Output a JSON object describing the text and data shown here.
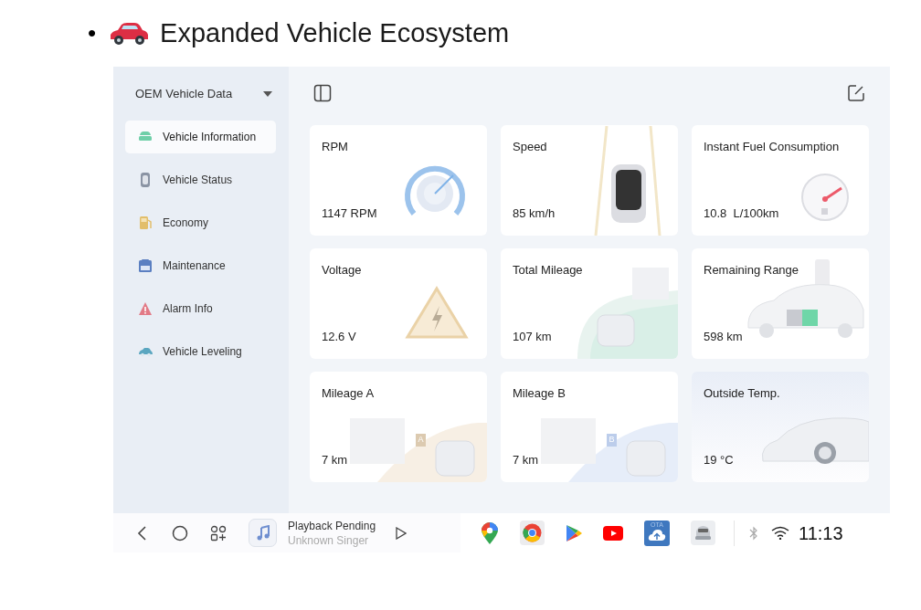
{
  "heading": {
    "bullet": "•",
    "title": "Expanded Vehicle Ecosystem"
  },
  "sidebar": {
    "title": "OEM Vehicle Data",
    "items": [
      {
        "label": "Vehicle Information",
        "kind": "info",
        "selected": true
      },
      {
        "label": "Vehicle Status",
        "kind": "status",
        "selected": false
      },
      {
        "label": "Economy",
        "kind": "economy",
        "selected": false
      },
      {
        "label": "Maintenance",
        "kind": "maintenance",
        "selected": false
      },
      {
        "label": "Alarm Info",
        "kind": "alarm",
        "selected": false
      },
      {
        "label": "Vehicle Leveling",
        "kind": "leveling",
        "selected": false
      }
    ]
  },
  "cards": [
    {
      "title": "RPM",
      "value": "1147 RPM",
      "kind": "rpm"
    },
    {
      "title": "Speed",
      "value": "85 km/h",
      "kind": "speed"
    },
    {
      "title": "Instant Fuel Consumption",
      "value": "10.8  L/100km",
      "kind": "fuel"
    },
    {
      "title": "Voltage",
      "value": "12.6 V",
      "kind": "voltage"
    },
    {
      "title": "Total Mileage",
      "value": "107 km",
      "kind": "mileage"
    },
    {
      "title": "Remaining Range",
      "value": "598 km",
      "kind": "range"
    },
    {
      "title": "Mileage A",
      "value": "7 km",
      "kind": "trip",
      "sign": "A"
    },
    {
      "title": "Mileage B",
      "value": "7 km",
      "kind": "trip",
      "sign": "B"
    },
    {
      "title": "Outside Temp.",
      "value": "19 °C",
      "kind": "temp"
    }
  ],
  "dock": {
    "nav": [
      {
        "kind": "back"
      },
      {
        "kind": "home"
      },
      {
        "kind": "apps"
      }
    ],
    "media": {
      "title": "Playback Pending",
      "artist": "Unknown Singer"
    },
    "apps": [
      {
        "kind": "maps"
      },
      {
        "kind": "browser"
      },
      {
        "kind": "store"
      },
      {
        "kind": "video"
      },
      {
        "kind": "ota",
        "label": "OTA"
      },
      {
        "kind": "car"
      }
    ],
    "status": [
      {
        "kind": "bluetooth"
      },
      {
        "kind": "wifi"
      }
    ],
    "time": "11:13"
  }
}
